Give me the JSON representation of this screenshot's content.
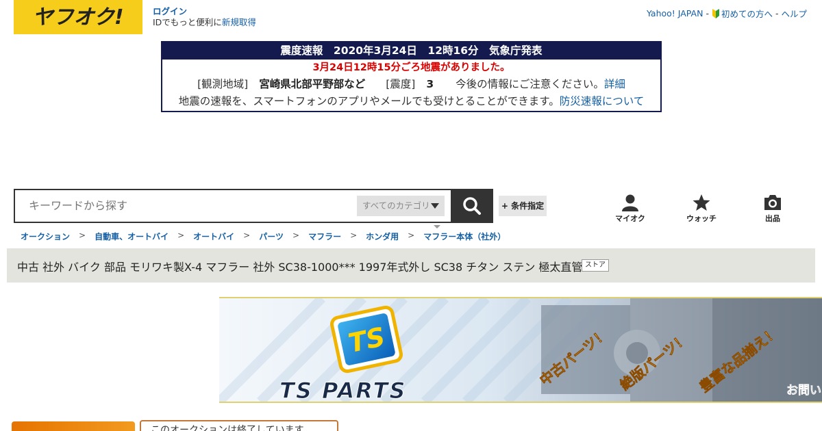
{
  "header": {
    "logo_text": "ヤフオク!",
    "login_label": "ログイン",
    "login_sub_text": "IDでもっと便利に",
    "register_label": "新規取得",
    "links": {
      "yahoo_japan": "Yahoo! JAPAN",
      "sep": "-",
      "first_time": "初めての方へ",
      "help": "ヘルプ"
    }
  },
  "quake": {
    "header": "震度速報　2020年3月24日　12時16分　気象庁発表",
    "alert": "3月24日12時15分ごろ地震がありました。",
    "area_label": "[観測地域]",
    "area_value": "宮崎県北部平野部など",
    "intensity_label": "[震度]",
    "intensity_value": "3",
    "caution": "今後の情報にご注意ください。",
    "detail_link": "詳細",
    "app_text": "地震の速報を、スマートフォンのアプリやメールでも受けとることができます。",
    "app_link": "防災速報について"
  },
  "search": {
    "placeholder": "キーワードから探す",
    "category": "すべてのカテゴリ",
    "condition_button": "+ 条件指定"
  },
  "utility": {
    "myauc": "マイオク",
    "watch": "ウォッチ",
    "sell": "出品"
  },
  "breadcrumbs": [
    "オークション",
    "自動車、オートバイ",
    "オートバイ",
    "パーツ",
    "マフラー",
    "ホンダ用",
    "マフラー本体（社外）"
  ],
  "breadcrumb_sep": ">",
  "item": {
    "title": "中古 社外 バイク 部品 モリワキ製X-4 マフラー 社外 SC38-1000*** 1997年式外し SC38 チタン ステン 極太直管",
    "store_badge": "ストア"
  },
  "banner": {
    "brand": "TS PARTS",
    "logo_text": "TS",
    "tag1": "中古パーツ！",
    "tag2": "絶版パーツ！",
    "tag3": "豊富な品揃え！",
    "contact": "お問い"
  },
  "ended": {
    "message": "このオークションは終了しています"
  },
  "colors": {
    "logo_yellow": "#f7cd1b",
    "link_blue": "#155fa4",
    "quake_navy": "#141a4e",
    "alert_red": "#d90000"
  }
}
